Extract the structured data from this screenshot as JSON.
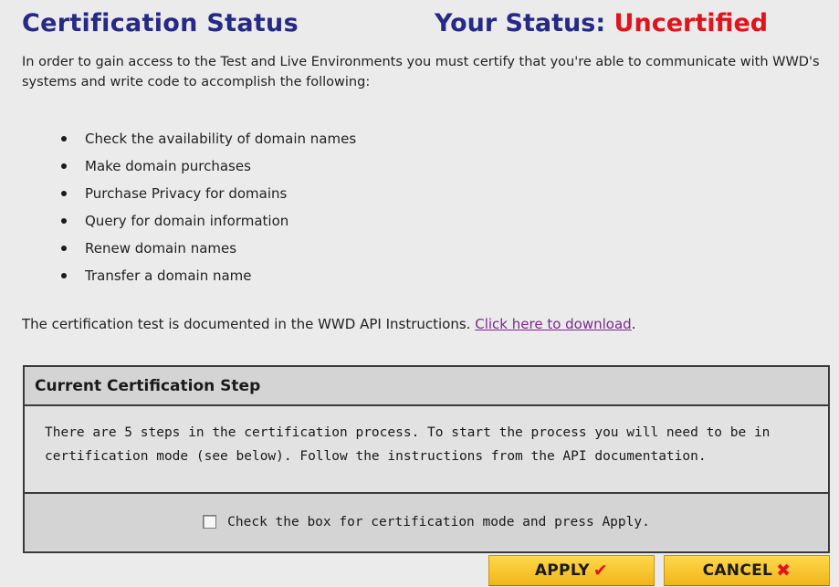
{
  "header": {
    "title": "Certification Status",
    "status_label": "Your Status:",
    "status_value": "Uncertified",
    "status_color": "#e0141a",
    "title_color": "#262a86"
  },
  "intro": {
    "text": "In order to gain access to the Test and Live Environments you must certify that you're able to communicate with WWD's systems and write code to accomplish the following:"
  },
  "requirements": [
    "Check the availability of domain names",
    "Make domain purchases",
    "Purchase Privacy for domains",
    "Query for domain information",
    "Renew domain names",
    "Transfer a domain name"
  ],
  "documentation": {
    "text": "The certification test is documented in the WWD API Instructions.",
    "link_label": "Click here to download",
    "trailing": "."
  },
  "step_panel": {
    "heading": "Current Certification Step",
    "body": "There are 5 steps in the certification process. To start the process you will need to be in certification mode (see below). Follow the instructions from the API documentation.",
    "checkbox_label": "Check the box for certification mode and press Apply.",
    "checkbox_checked": false
  },
  "actions": {
    "apply_label": "APPLY",
    "apply_icon": "checkmark-icon",
    "cancel_label": "CANCEL",
    "cancel_icon": "x-icon",
    "button_color": "#f6c531"
  }
}
